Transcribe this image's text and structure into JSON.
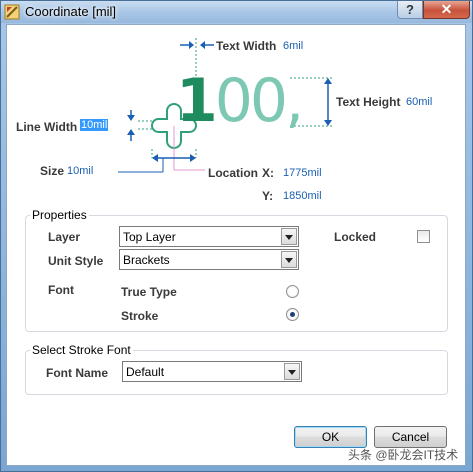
{
  "window": {
    "title": "Coordinate [mil]",
    "help_label": "?",
    "close_label": "✕"
  },
  "diagram": {
    "text_width_label": "Text Width",
    "text_width_value": "6mil",
    "text_height_label": "Text Height",
    "text_height_value": "60mil",
    "line_width_label": "Line Width",
    "line_width_value": "10mil",
    "size_label": "Size",
    "size_value": "10mil",
    "location_label": "Location",
    "x_label": "X:",
    "x_value": "1775mil",
    "y_label": "Y:",
    "y_value": "1850mil",
    "sample_text_first": "1",
    "sample_text_rest": "00,"
  },
  "properties": {
    "group_title": "Properties",
    "layer_label": "Layer",
    "layer_value": "Top Layer",
    "locked_label": "Locked",
    "locked_checked": false,
    "unit_style_label": "Unit Style",
    "unit_style_value": "Brackets",
    "font_label": "Font",
    "true_type_label": "True Type",
    "stroke_label": "Stroke",
    "selected_font": "Stroke"
  },
  "stroke_font": {
    "group_title": "Select Stroke Font",
    "font_name_label": "Font Name",
    "font_name_value": "Default"
  },
  "buttons": {
    "ok_label": "OK",
    "cancel_label": "Cancel"
  },
  "watermark": "头条 @卧龙会IT技术",
  "colors": {
    "accent_text": "#1a5fb4",
    "sample_green": "#1e8c5e",
    "selection": "#3399ff"
  }
}
